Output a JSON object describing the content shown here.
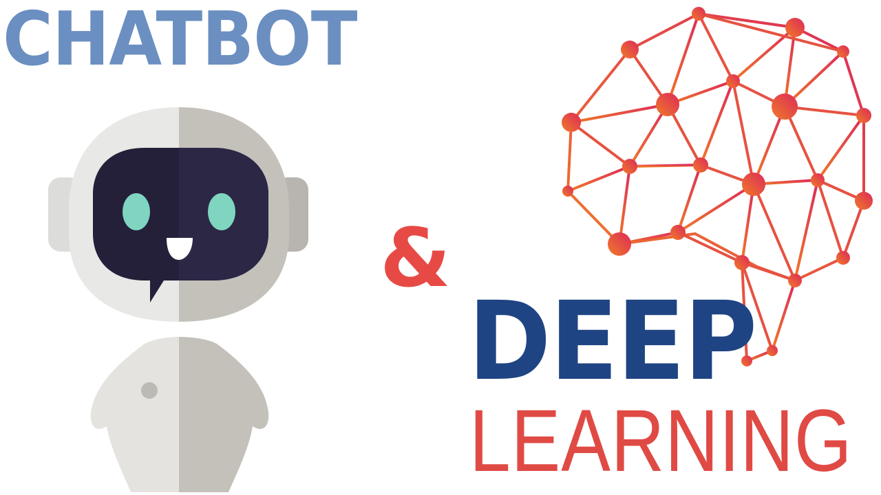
{
  "title_left": "CHATBOT",
  "ampersand": "&",
  "title_right_line1": "DEEP",
  "title_right_line2": "LEARNING",
  "colors": {
    "chatbot_text": "#6b8fc1",
    "ampersand": "#e74a45",
    "deep_text": "#1f4483",
    "learning_text": "#e04a45",
    "robot_face": "#2a2540",
    "robot_eyes": "#7fd5c0",
    "brain_gradient_start": "#f07a28",
    "brain_gradient_end": "#dc2a5a"
  },
  "illustrations": {
    "robot": "robot-icon",
    "brain": "neural-brain-icon"
  }
}
